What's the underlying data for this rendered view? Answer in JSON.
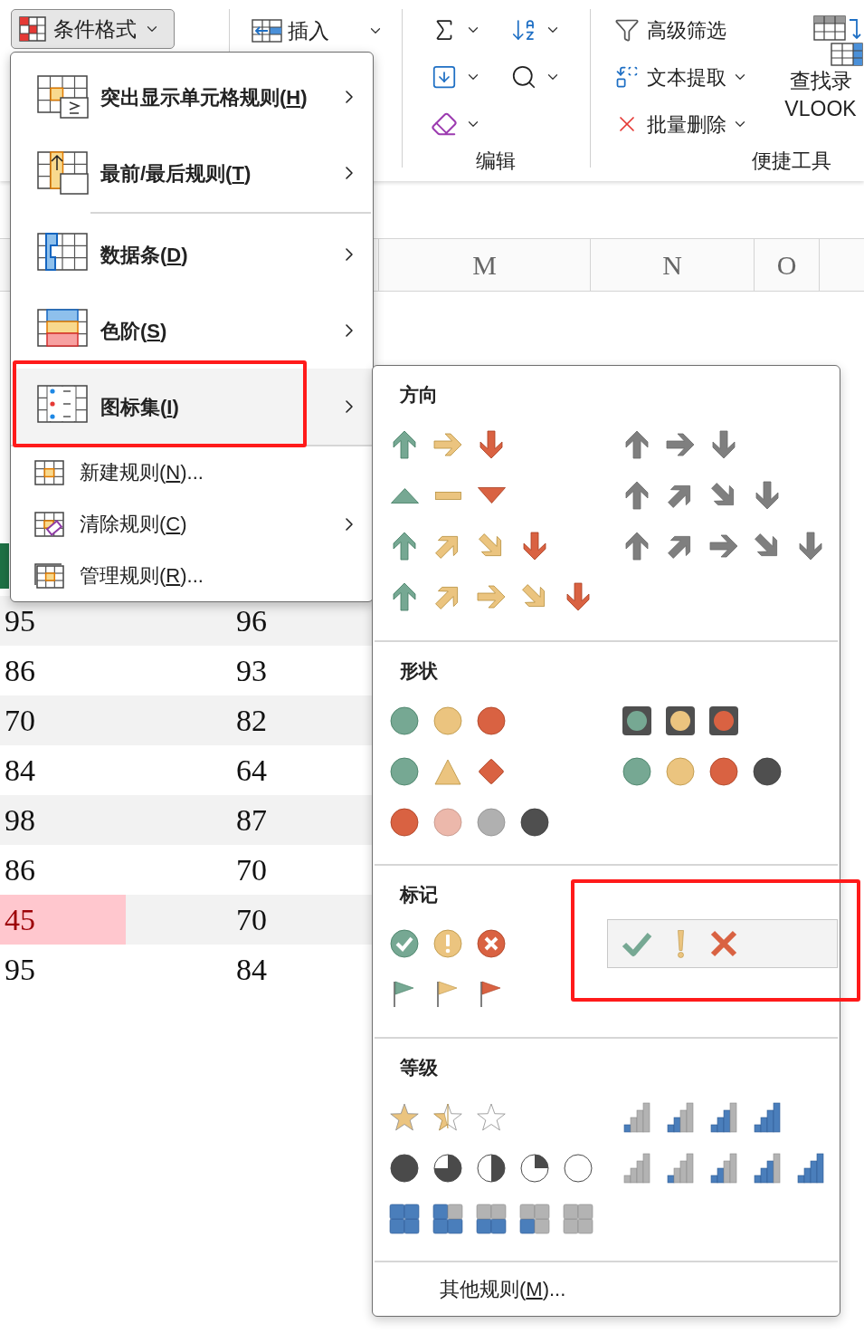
{
  "ribbon": {
    "format_button": {
      "label": "条件格式",
      "pressed": true
    },
    "insert": {
      "label": "插入"
    },
    "editing_group": {
      "label": "编辑"
    },
    "tools_group": {
      "label": "便捷工具",
      "items": [
        {
          "label": "高级筛选",
          "dropdown": false
        },
        {
          "label": "文本提取",
          "dropdown": true
        },
        {
          "label": "批量删除",
          "dropdown": true
        }
      ],
      "big_button": {
        "lines": [
          "查找录",
          "VLOOK"
        ]
      }
    }
  },
  "sheet": {
    "column_headers": [
      "M",
      "N",
      "O"
    ],
    "rows": [
      {
        "cells": [
          {
            "value": "95",
            "flagged": false
          },
          {
            "value": "96",
            "flagged": false
          }
        ]
      },
      {
        "cells": [
          {
            "value": "86",
            "flagged": false
          },
          {
            "value": "93",
            "flagged": false
          }
        ]
      },
      {
        "cells": [
          {
            "value": "70",
            "flagged": false
          },
          {
            "value": "82",
            "flagged": false
          }
        ]
      },
      {
        "cells": [
          {
            "value": "84",
            "flagged": false
          },
          {
            "value": "64",
            "flagged": false
          }
        ]
      },
      {
        "cells": [
          {
            "value": "98",
            "flagged": false
          },
          {
            "value": "87",
            "flagged": false
          }
        ]
      },
      {
        "cells": [
          {
            "value": "86",
            "flagged": false
          },
          {
            "value": "70",
            "flagged": false
          }
        ]
      },
      {
        "cells": [
          {
            "value": "45",
            "flagged": true
          },
          {
            "value": "70",
            "flagged": false
          }
        ]
      },
      {
        "cells": [
          {
            "value": "95",
            "flagged": false
          },
          {
            "value": "84",
            "flagged": false
          }
        ]
      }
    ]
  },
  "menu": {
    "items": [
      {
        "kind": "large",
        "before": "突出显示单元格规则(",
        "key": "H",
        "after": ")",
        "submenu": true,
        "selected": false
      },
      {
        "kind": "large",
        "before": "最前/最后规则(",
        "key": "T",
        "after": ")",
        "submenu": true,
        "selected": false
      },
      {
        "kind": "large",
        "before": "数据条(",
        "key": "D",
        "after": ")",
        "submenu": true,
        "selected": false
      },
      {
        "kind": "large",
        "before": "色阶(",
        "key": "S",
        "after": ")",
        "submenu": true,
        "selected": false
      },
      {
        "kind": "large",
        "before": "图标集(",
        "key": "I",
        "after": ")",
        "submenu": true,
        "selected": true
      },
      {
        "kind": "small",
        "before": "新建规则(",
        "key": "N",
        "after": ")...",
        "submenu": false,
        "selected": false
      },
      {
        "kind": "small",
        "before": "清除规则(",
        "key": "C",
        "after": ")",
        "submenu": true,
        "selected": false
      },
      {
        "kind": "small",
        "before": "管理规则(",
        "key": "R",
        "after": ")...",
        "submenu": false,
        "selected": false
      }
    ]
  },
  "icon_sets_menu": {
    "sections": [
      {
        "title": "方向",
        "left": [
          {
            "kind": "arrows3",
            "selected": false
          },
          {
            "kind": "triangles3",
            "selected": false
          },
          {
            "kind": "arrows4",
            "selected": false
          },
          {
            "kind": "arrows5",
            "selected": false
          }
        ],
        "right": [
          {
            "kind": "arrows3-gray",
            "selected": false
          },
          {
            "kind": "arrows4-gray",
            "selected": false
          },
          {
            "kind": "arrows5-gray",
            "selected": false
          }
        ]
      },
      {
        "title": "形状",
        "left": [
          {
            "kind": "circles3",
            "selected": false
          },
          {
            "kind": "shapes3",
            "selected": false
          },
          {
            "kind": "red-to-black",
            "selected": false
          }
        ],
        "right": [
          {
            "kind": "traffic-lights",
            "selected": false
          },
          {
            "kind": "circles4",
            "selected": false
          }
        ]
      },
      {
        "title": "标记",
        "left": [
          {
            "kind": "symbols-circled",
            "selected": false
          },
          {
            "kind": "flags",
            "selected": false
          }
        ],
        "right": [
          {
            "kind": "symbols",
            "selected": true
          }
        ]
      },
      {
        "title": "等级",
        "left": [
          {
            "kind": "stars",
            "selected": false
          },
          {
            "kind": "quarters",
            "selected": false
          },
          {
            "kind": "boxes",
            "selected": false
          }
        ],
        "right": [
          {
            "kind": "bars4",
            "selected": false
          },
          {
            "kind": "bars5",
            "selected": false
          }
        ]
      }
    ],
    "footer": {
      "before": "其他规则(",
      "key": "M",
      "after": ")..."
    }
  }
}
